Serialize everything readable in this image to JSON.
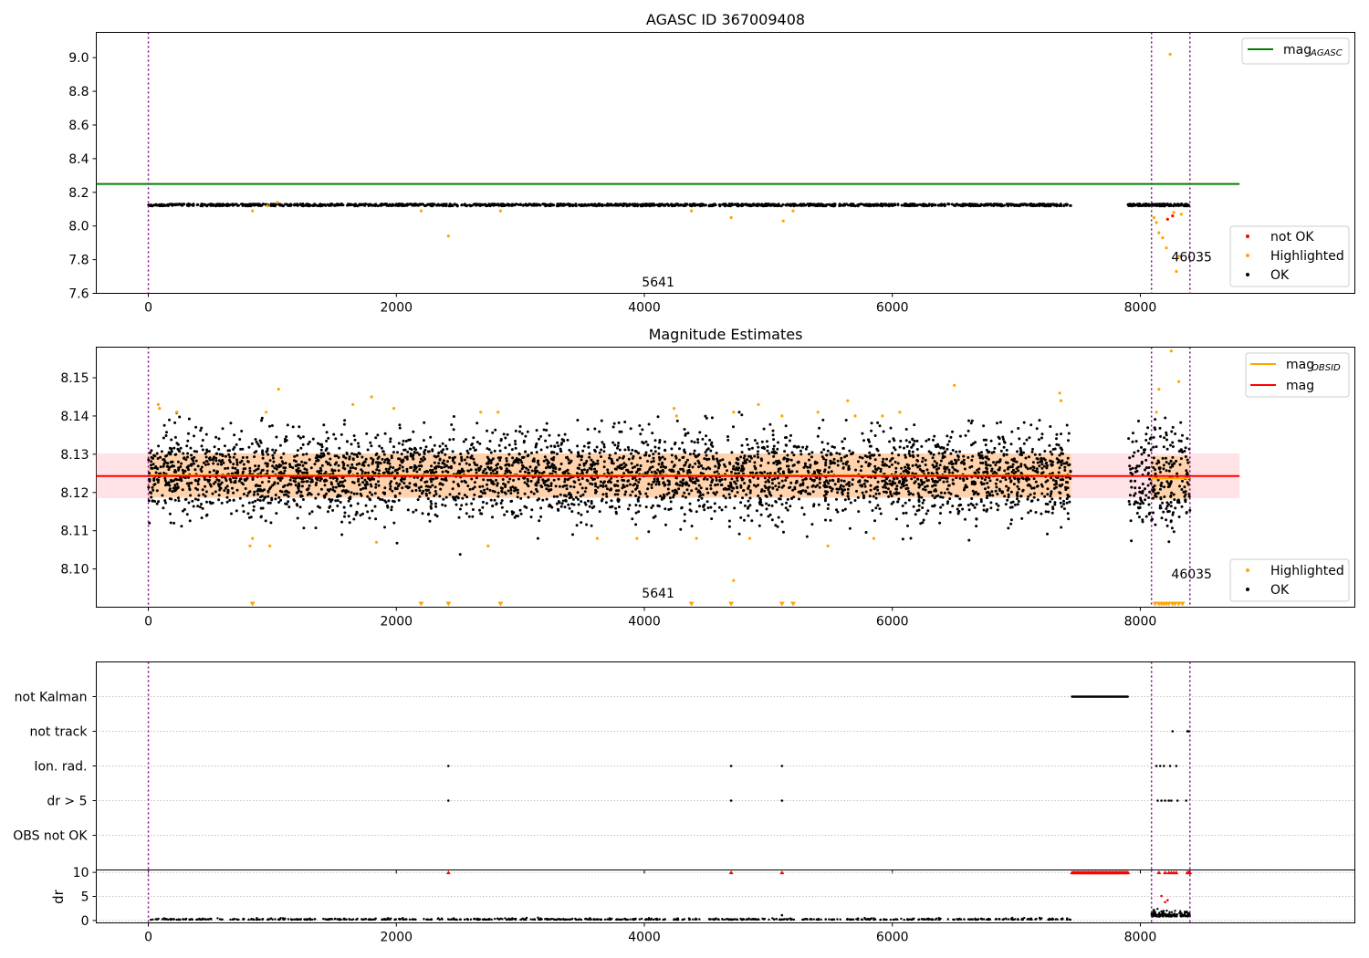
{
  "chart_data": [
    {
      "type": "scatter",
      "title": "AGASC ID 367009408",
      "xlim": [
        -420,
        9730
      ],
      "ylim": [
        7.6,
        9.15
      ],
      "x_ticks": [
        "0",
        "2000",
        "4000",
        "6000",
        "8000"
      ],
      "x_tick_values": [
        0,
        2000,
        4000,
        6000,
        8000
      ],
      "y_ticks": [
        "7.6",
        "7.8",
        "8.0",
        "8.2",
        "8.4",
        "8.6",
        "8.8",
        "9.0"
      ],
      "y_tick_values": [
        7.6,
        7.8,
        8.0,
        8.2,
        8.4,
        8.6,
        8.8,
        9.0
      ],
      "grid": false,
      "obs_boundaries": [
        0,
        8090,
        8400
      ],
      "obs_labels": [
        {
          "x": 3980,
          "y": 7.64,
          "text": "5641"
        },
        {
          "x": 8250,
          "y": 7.79,
          "text": "46035"
        }
      ],
      "line_mag_agasc": {
        "value": 8.25,
        "x_range": [
          -420,
          8800
        ],
        "color": "#008000"
      },
      "ok_segments": [
        {
          "x_range": [
            0,
            7440
          ],
          "center": 8.125,
          "spread": 0.012,
          "count": 1400
        },
        {
          "x_range": [
            7900,
            8400
          ],
          "center": 8.125,
          "spread": 0.012,
          "count": 150
        }
      ],
      "highlighted_points": [
        [
          840,
          8.09
        ],
        [
          960,
          8.12
        ],
        [
          1040,
          8.14
        ],
        [
          2200,
          8.09
        ],
        [
          2420,
          7.94
        ],
        [
          2840,
          8.09
        ],
        [
          4380,
          8.09
        ],
        [
          4700,
          8.05
        ],
        [
          5120,
          8.03
        ],
        [
          5200,
          8.09
        ],
        [
          8110,
          8.05
        ],
        [
          8130,
          8.02
        ],
        [
          8150,
          7.96
        ],
        [
          8180,
          7.93
        ],
        [
          8210,
          7.87
        ],
        [
          8240,
          9.02
        ],
        [
          8270,
          8.08
        ],
        [
          8290,
          7.73
        ],
        [
          8310,
          7.82
        ],
        [
          8330,
          8.07
        ]
      ],
      "not_ok_points": [
        [
          8220,
          8.04
        ],
        [
          8260,
          8.06
        ]
      ],
      "legend_upper": [
        {
          "label": "mag",
          "subscript": "AGASC",
          "color": "#008000",
          "marker": "line"
        }
      ],
      "legend_lower": [
        {
          "label": "not OK",
          "color": "#ff0000",
          "marker": "dot"
        },
        {
          "label": "Highlighted",
          "color": "#ffa500",
          "marker": "dot"
        },
        {
          "label": "OK",
          "color": "#000000",
          "marker": "dot"
        }
      ]
    },
    {
      "type": "scatter",
      "title": "Magnitude Estimates",
      "xlim": [
        -420,
        9730
      ],
      "ylim": [
        8.09,
        8.158
      ],
      "x_ticks": [
        "0",
        "2000",
        "4000",
        "6000",
        "8000"
      ],
      "x_tick_values": [
        0,
        2000,
        4000,
        6000,
        8000
      ],
      "y_ticks": [
        "8.10",
        "8.11",
        "8.12",
        "8.13",
        "8.14",
        "8.15"
      ],
      "y_tick_values": [
        8.1,
        8.11,
        8.12,
        8.13,
        8.14,
        8.15
      ],
      "grid": false,
      "obs_boundaries": [
        0,
        8090,
        8400
      ],
      "obs_labels": [
        {
          "x": 3980,
          "y": 8.0925,
          "text": "5641"
        },
        {
          "x": 8250,
          "y": 8.0975,
          "text": "46035"
        }
      ],
      "mag_line": {
        "value": 8.1243,
        "x_range": [
          -420,
          8800
        ],
        "color": "#ff0000"
      },
      "mag_band": {
        "low": 8.1185,
        "high": 8.1302,
        "x_range": [
          -420,
          8800
        ],
        "color": "#ffb6c1"
      },
      "mag_obsid": [
        {
          "value": 8.1245,
          "x_range": [
            0,
            7440
          ],
          "band": [
            8.1188,
            8.1302
          ]
        },
        {
          "value": 8.1237,
          "x_range": [
            8090,
            8400
          ],
          "band": [
            8.118,
            8.1295
          ]
        }
      ],
      "ok_segments": [
        {
          "x_range": [
            0,
            7440
          ],
          "center": 8.1245,
          "spread": 0.0055,
          "count": 3800
        },
        {
          "x_range": [
            7900,
            8400
          ],
          "center": 8.1235,
          "spread": 0.007,
          "count": 260
        }
      ],
      "highlighted_points": [
        [
          80,
          8.143
        ],
        [
          90,
          8.142
        ],
        [
          230,
          8.141
        ],
        [
          820,
          8.106
        ],
        [
          840,
          8.108
        ],
        [
          950,
          8.141
        ],
        [
          980,
          8.106
        ],
        [
          1050,
          8.147
        ],
        [
          1650,
          8.143
        ],
        [
          1800,
          8.145
        ],
        [
          1840,
          8.107
        ],
        [
          1980,
          8.142
        ],
        [
          2680,
          8.141
        ],
        [
          2740,
          8.106
        ],
        [
          2820,
          8.141
        ],
        [
          3620,
          8.108
        ],
        [
          3940,
          8.108
        ],
        [
          4240,
          8.142
        ],
        [
          4260,
          8.14
        ],
        [
          4420,
          8.108
        ],
        [
          4720,
          8.141
        ],
        [
          4720,
          8.097
        ],
        [
          4850,
          8.108
        ],
        [
          4920,
          8.143
        ],
        [
          5110,
          8.14
        ],
        [
          5400,
          8.141
        ],
        [
          5480,
          8.106
        ],
        [
          5640,
          8.144
        ],
        [
          5700,
          8.14
        ],
        [
          5850,
          8.108
        ],
        [
          5920,
          8.14
        ],
        [
          6060,
          8.141
        ],
        [
          6500,
          8.148
        ],
        [
          7350,
          8.146
        ],
        [
          7360,
          8.144
        ],
        [
          8130,
          8.141
        ],
        [
          8150,
          8.147
        ],
        [
          8250,
          8.157
        ],
        [
          8310,
          8.149
        ]
      ],
      "below_markers_x": [
        840,
        2200,
        2420,
        2840,
        4380,
        4700,
        5110,
        5200,
        8120,
        8150,
        8170,
        8190,
        8210,
        8230,
        8260,
        8280,
        8310,
        8340
      ],
      "legend_upper": [
        {
          "label": "mag",
          "subscript": "OBSID",
          "color": "#ffa500",
          "marker": "line"
        },
        {
          "label": "mag",
          "subscript": "",
          "color": "#ff0000",
          "marker": "line"
        }
      ],
      "legend_lower": [
        {
          "label": "Highlighted",
          "color": "#ffa500",
          "marker": "dot"
        },
        {
          "label": "OK",
          "color": "#000000",
          "marker": "dot"
        }
      ]
    },
    {
      "type": "scatter",
      "title": "",
      "xlim": [
        -420,
        9730
      ],
      "x_ticks": [],
      "y_categories": [
        "not Kalman",
        "not track",
        "Ion. rad.",
        "dr > 5",
        "OBS not OK"
      ],
      "grid": true,
      "obs_boundaries": [
        0,
        8090,
        8400
      ],
      "flag_points": {
        "not Kalman": {
          "ranges": [
            [
              7450,
              7900
            ]
          ],
          "points": []
        },
        "not track": {
          "ranges": [
            [
              8380,
              8400
            ]
          ],
          "points": [
            8260
          ]
        },
        "Ion. rad.": {
          "ranges": [],
          "points": [
            2420,
            4700,
            5110,
            8130,
            8160,
            8190,
            8240,
            8290
          ]
        },
        "dr > 5": {
          "ranges": [],
          "points": [
            2420,
            4700,
            5110,
            8140,
            8170,
            8200,
            8230,
            8250,
            8300,
            8370
          ]
        },
        "OBS not OK": {
          "ranges": [],
          "points": []
        }
      }
    },
    {
      "type": "scatter",
      "title": "",
      "ylabel": "dr",
      "xlim": [
        -420,
        9730
      ],
      "ylim": [
        -0.5,
        10.5
      ],
      "x_ticks": [
        "0",
        "2000",
        "4000",
        "6000",
        "8000"
      ],
      "x_tick_values": [
        0,
        2000,
        4000,
        6000,
        8000
      ],
      "y_ticks": [
        "0",
        "5",
        "10"
      ],
      "y_tick_values": [
        0,
        5,
        10
      ],
      "grid": true,
      "ok_segments": [
        {
          "x_range": [
            0,
            7440
          ],
          "center": 0.15,
          "spread": 0.15,
          "count": 700
        },
        {
          "x_range": [
            8090,
            8400
          ],
          "center": 0.8,
          "spread": 0.7,
          "count": 120
        }
      ],
      "clipped_markers_x_ranges": [
        [
          7450,
          7900
        ],
        [
          8380,
          8400
        ]
      ],
      "clipped_markers_x": [
        2420,
        4700,
        5110,
        8150,
        8200,
        8230,
        8250,
        8270,
        8290
      ],
      "red_points": [
        [
          8170,
          5.1
        ],
        [
          8220,
          4.2
        ],
        [
          8200,
          3.8
        ]
      ]
    }
  ]
}
